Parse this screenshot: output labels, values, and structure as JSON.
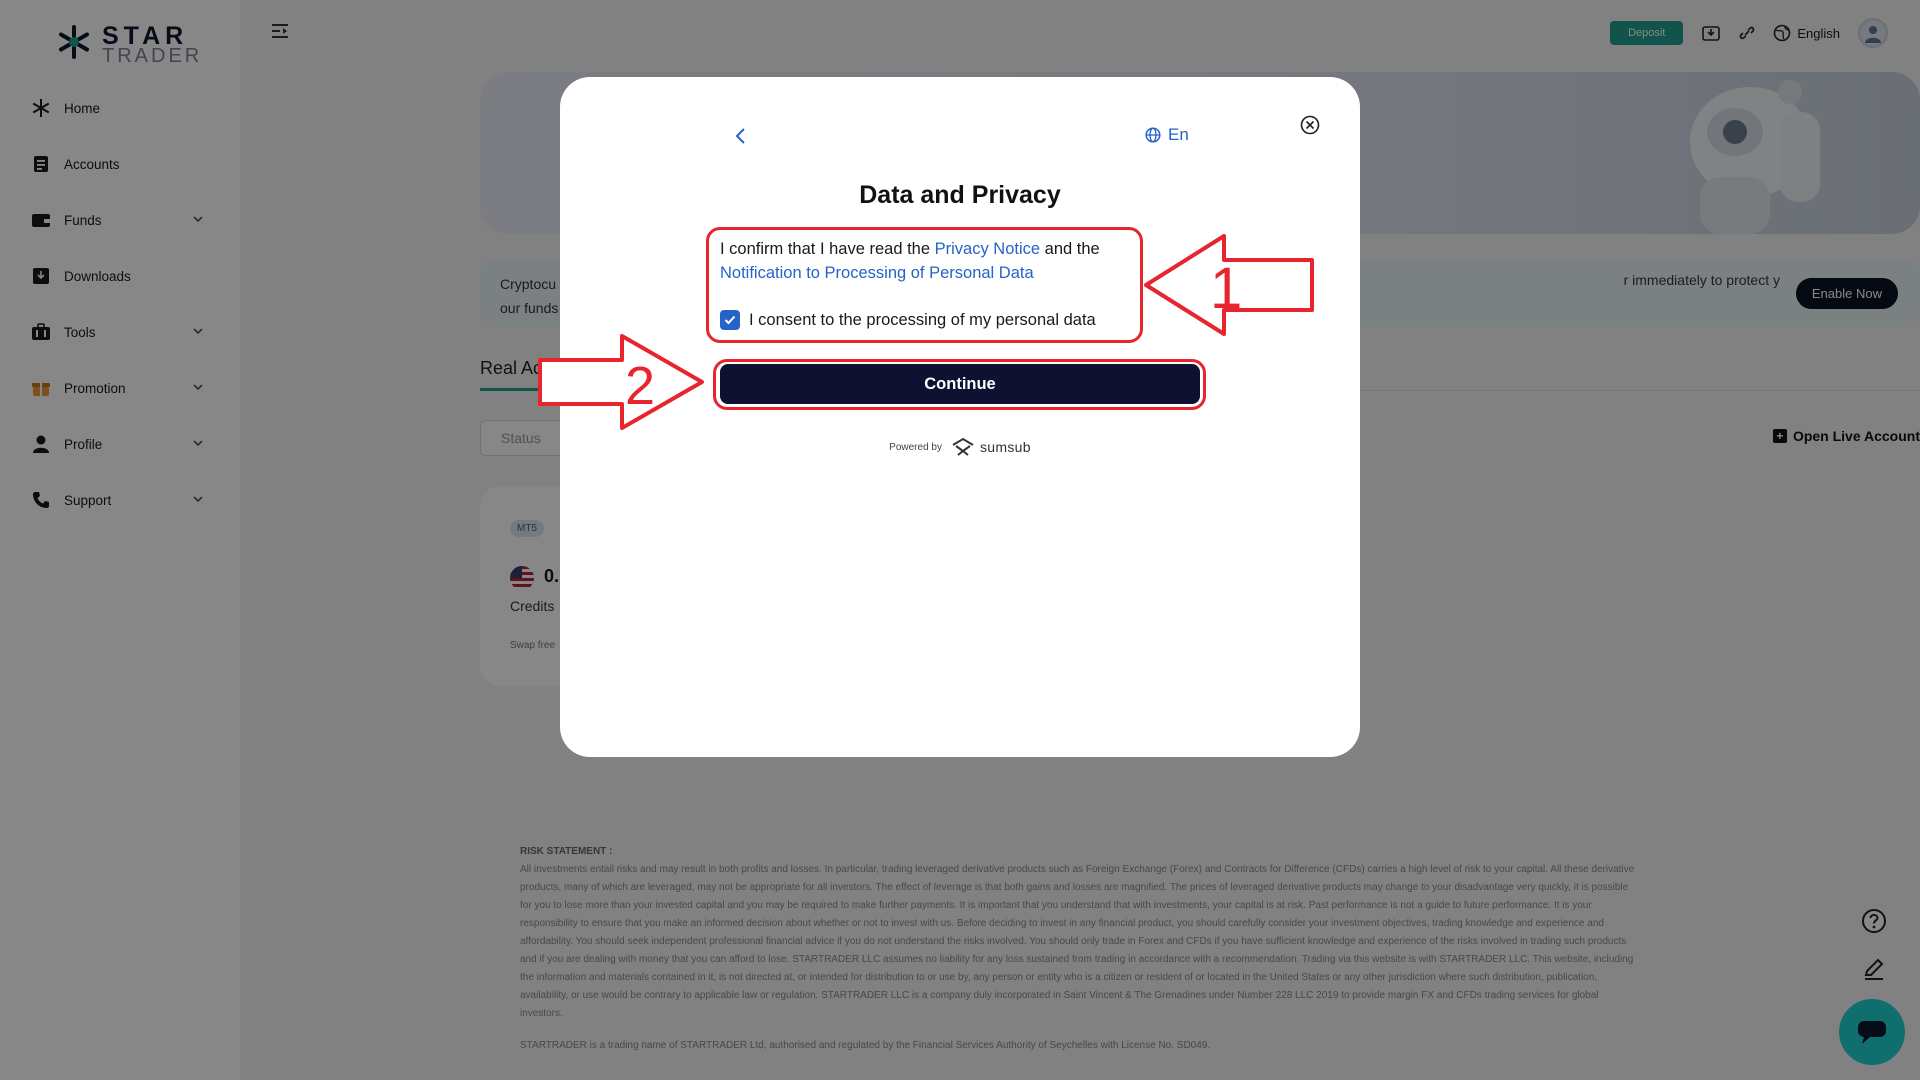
{
  "brand": {
    "star": "STAR",
    "trader": "TRADER"
  },
  "sidebar": {
    "items": [
      {
        "label": "Home",
        "icon": "star-icon"
      },
      {
        "label": "Accounts",
        "icon": "document-icon"
      },
      {
        "label": "Funds",
        "icon": "wallet-icon"
      },
      {
        "label": "Downloads",
        "icon": "download-icon"
      },
      {
        "label": "Tools",
        "icon": "toolbox-icon"
      },
      {
        "label": "Promotion",
        "icon": "gift-icon"
      },
      {
        "label": "Profile",
        "icon": "user-icon"
      },
      {
        "label": "Support",
        "icon": "phone-icon"
      }
    ]
  },
  "topbar": {
    "deposit": "Deposit",
    "language": "English"
  },
  "page": {
    "alert_left": "Cryptocu… our funds",
    "alert_left_1": "Cryptocu",
    "alert_left_2": "our funds",
    "alert_right": "r immediately to protect y",
    "enable_now": "Enable Now",
    "tab_real": "Real Acc",
    "status_placeholder": "Status",
    "open_live": "Open Live Account",
    "card": {
      "platform": "MT5",
      "balance": "0.",
      "credits": "Credits",
      "swap": "Swap free"
    }
  },
  "risk": {
    "title": "RISK STATEMENT :",
    "body": "All investments entail risks and may result in both profits and losses. In particular, trading leveraged derivative products such as Foreign Exchange (Forex) and Contracts for Difference (CFDs) carries a high level of risk to your capital. All these derivative products, many of which are leveraged, may not be appropriate for all investors. The effect of leverage is that both gains and losses are magnified. The prices of leveraged derivative products may change to your disadvantage very quickly, it is possible for you to lose more than your invested capital and you may be required to make further payments. It is important that you understand that with investments, your capital is at risk. Past performance is not a guide to future performance. It is your responsibility to ensure that you make an informed decision about whether or not to invest with us. Before deciding to invest in any financial product, you should carefully consider your investment objectives, trading knowledge and experience and affordability. You should seek independent professional financial advice if you do not understand the risks involved. You should only trade in Forex and CFDs if you have sufficient knowledge and experience of the risks involved in trading such products and if you are dealing with money that you can afford to lose. STARTRADER LLC assumes no liability for any loss sustained from trading in accordance with a recommendation. Trading via this website is with STARTRADER LLC. This website, including the information and materials contained in it, is not directed at, or intended for distribution to or use by, any person or entity who is a citizen or resident of or located in the United States or any other jurisdiction where such distribution, publication, availability, or use would be contrary to applicable law or regulation. STARTRADER LLC is a company duly incorporated in Saint Vincent & The Grenadines under Number 228 LLC 2019 to provide margin FX and CFDs trading services for global investors.",
    "footer": "STARTRADER is a trading name of STARTRADER Ltd, authorised and regulated by the Financial Services Authority of Seychelles with License No. SD049."
  },
  "modal": {
    "language": "En",
    "title": "Data and Privacy",
    "confirm_prefix": "I confirm that I have read the ",
    "privacy_notice": "Privacy Notice",
    "confirm_mid": " and the",
    "notification_link": "Notification to Processing of Personal Data",
    "consent": "I consent to the processing of my personal data",
    "consent_checked": true,
    "continue": "Continue",
    "powered_by": "Powered by",
    "provider": "sumsub"
  },
  "annotations": {
    "step1": "1",
    "step2": "2",
    "color": "#e8252f"
  },
  "colors": {
    "accent": "#1f9f8e",
    "link": "#2563c8",
    "button_dark": "#0e1230",
    "chat": "#1fd1d0"
  }
}
